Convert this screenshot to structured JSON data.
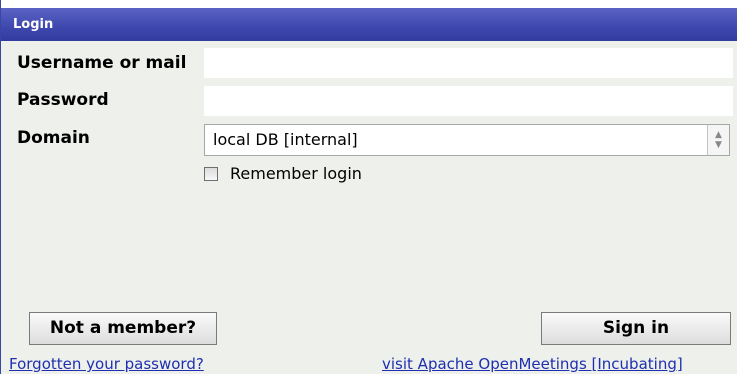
{
  "window": {
    "title": "Login"
  },
  "form": {
    "username_label": "Username or mail",
    "username_value": "",
    "password_label": "Password",
    "password_value": "",
    "domain_label": "Domain",
    "domain_selected": "local DB [internal]",
    "remember_label": "Remember login",
    "remember_checked": false
  },
  "buttons": {
    "not_member": "Not a member?",
    "sign_in": "Sign in"
  },
  "links": {
    "forgot_password": "Forgotten your password?",
    "visit_apache": "visit Apache OpenMeetings [Incubating]"
  },
  "colors": {
    "titlebar": "#3d47ad",
    "background": "#edf0eb",
    "link": "#1f2fb0"
  }
}
